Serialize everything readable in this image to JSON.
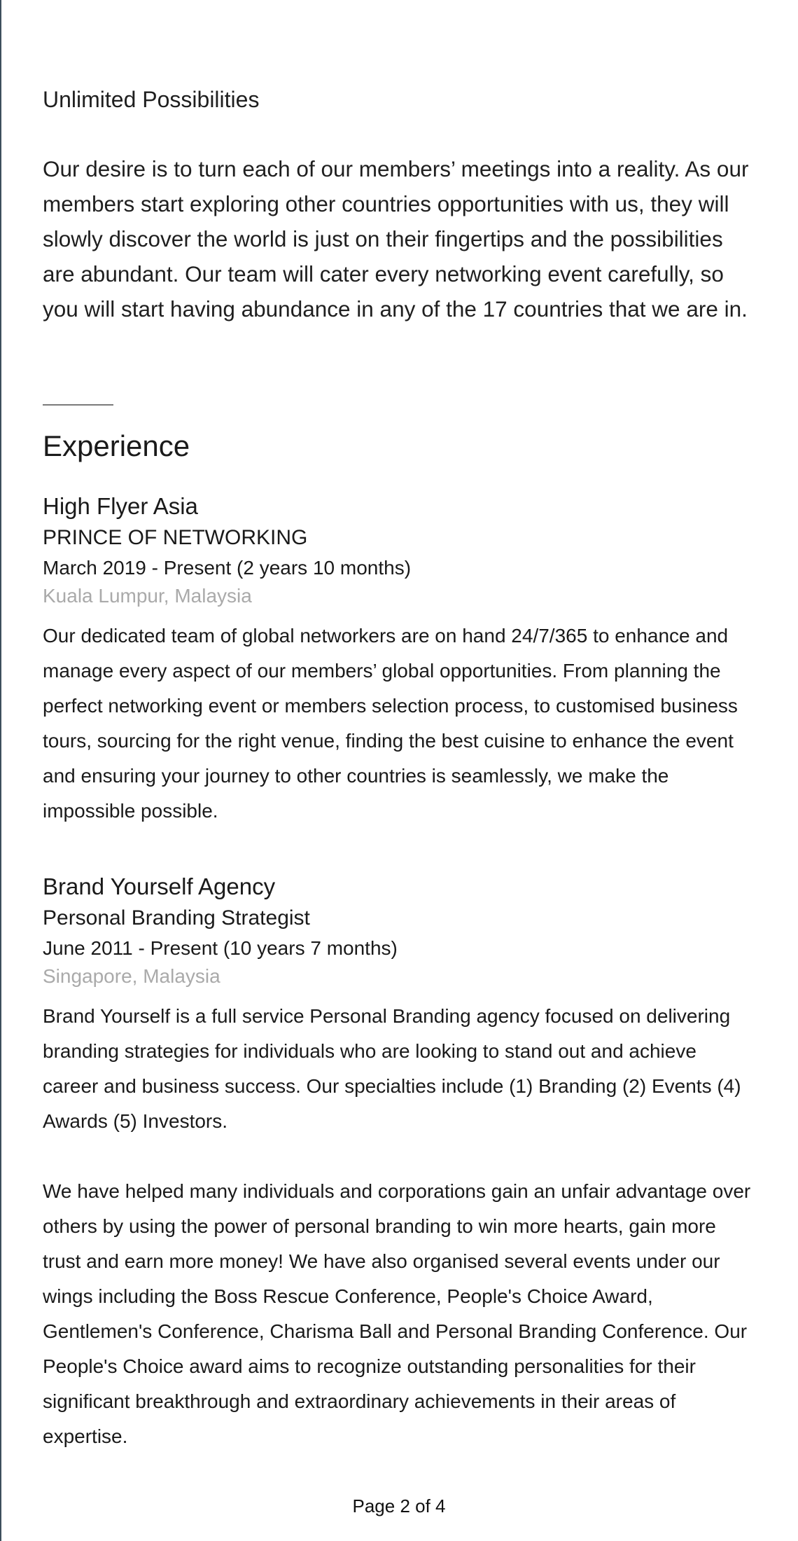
{
  "summary": {
    "heading": "Unlimited Possibilities",
    "body": "Our desire is to turn each of our members’ meetings into a reality. As our members start exploring other countries opportunities with us, they will slowly discover the world is just on their fingertips and the possibilities are abundant. Our team will cater every networking event carefully, so you will start having abundance in any of the 17 countries that we are in."
  },
  "experience": {
    "title": "Experience",
    "jobs": [
      {
        "company": "High Flyer Asia",
        "title": "PRINCE OF NETWORKING",
        "dates": "March 2019 - Present (2 years 10 months)",
        "location": "Kuala Lumpur, Malaysia",
        "description": [
          "Our dedicated team of global networkers are on hand 24/7/365 to enhance and manage every aspect of our members’ global opportunities. From planning the perfect networking event or members selection process, to customised business tours, sourcing for the right venue, finding the best cuisine to enhance the event and ensuring your journey to other countries is seamlessly, we make the impossible possible."
        ]
      },
      {
        "company": "Brand Yourself Agency",
        "title": "Personal Branding Strategist",
        "dates": "June 2011 - Present (10 years 7 months)",
        "location": "Singapore, Malaysia",
        "description": [
          "Brand Yourself is a full service Personal Branding agency focused on delivering branding strategies for individuals who are looking to stand out and achieve career and business success. Our specialties include (1) Branding (2) Events (4) Awards (5) Investors.",
          "We have helped many individuals and corporations gain an unfair advantage over others by using the power of personal branding to win more hearts, gain more trust and earn more money! We have also organised several events under our wings including the Boss Rescue Conference, People's Choice Award, Gentlemen's Conference, Charisma Ball and Personal Branding Conference. Our People's Choice award aims to recognize outstanding personalities for their significant breakthrough and extraordinary achievements in their areas of expertise."
        ]
      }
    ]
  },
  "footer": {
    "page_label": "Page 2 of 4"
  },
  "colors": {
    "text": "#1a1a1a",
    "muted": "#aaaaaa",
    "rule": "#3d4f5c"
  }
}
